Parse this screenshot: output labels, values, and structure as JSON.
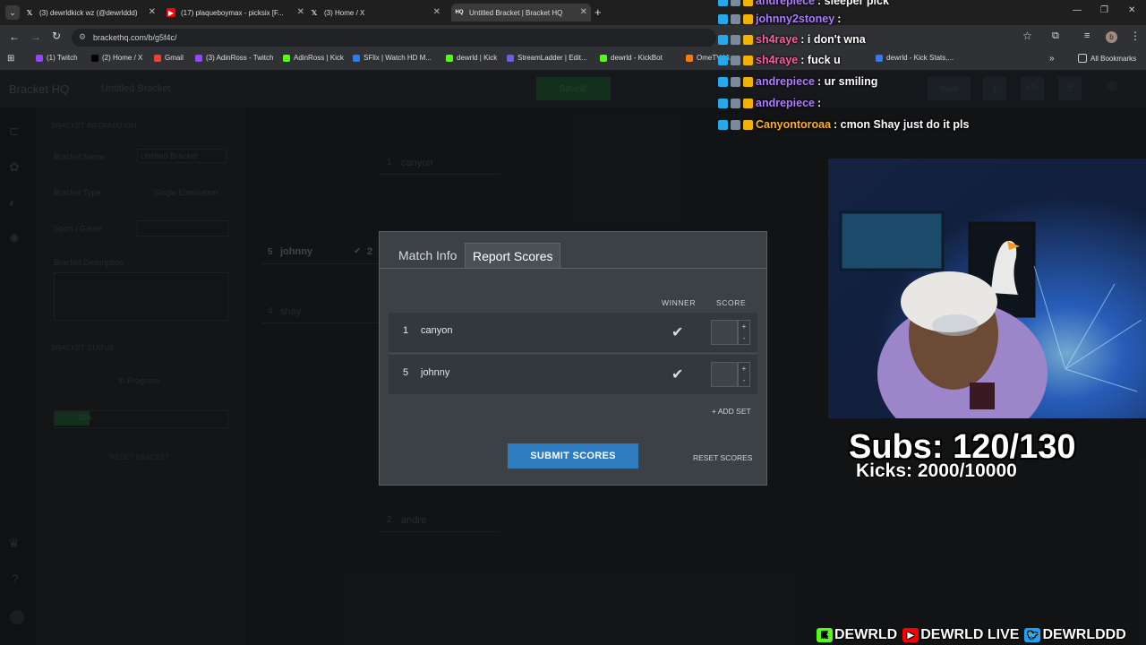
{
  "browser": {
    "tabs": [
      {
        "title": "(3) dewrldkick wz (@dewrlddd)",
        "icon": "x-logo-icon",
        "active": false
      },
      {
        "title": "(17) plaqueboymax - picksix [F...",
        "icon": "youtube-icon",
        "active": false
      },
      {
        "title": "(3) Home / X",
        "icon": "x-logo-icon",
        "active": false
      },
      {
        "title": "Untitled Bracket | Bracket HQ",
        "icon": "brackethq-icon",
        "active": true
      }
    ],
    "url": "brackethq.com/b/g5f4c/",
    "bookmarks": [
      {
        "label": "(1) Twitch",
        "color": "#9146ff"
      },
      {
        "label": "(2) Home / X",
        "color": "#000000"
      },
      {
        "label": "Gmail",
        "color": "#ea4335"
      },
      {
        "label": "(3) AdinRoss - Twitch",
        "color": "#9146ff"
      },
      {
        "label": "AdinRoss | Kick",
        "color": "#53fc18"
      },
      {
        "label": "SFlix | Watch HD M...",
        "color": "#2b7de9"
      },
      {
        "label": "dewrld | Kick",
        "color": "#53fc18"
      },
      {
        "label": "StreamLadder | Edit...",
        "color": "#6c5ce7"
      },
      {
        "label": "dewrld - KickBot",
        "color": "#53fc18"
      },
      {
        "label": "OmeTV Vi...",
        "color": "#ff7a00"
      },
      {
        "label": "dewrld - Kick Stats,...",
        "color": "#3478f6"
      }
    ],
    "all_bookmarks": "All Bookmarks"
  },
  "app": {
    "logo": "Bracket HQ",
    "bracket_title": "Untitled Bracket",
    "saved": "Saved!",
    "save_label": "Save",
    "info": {
      "section_title": "BRACKET INFORMATION",
      "name_label": "Bracket Name",
      "name_value": "Untitled Bracket",
      "type_label": "Bracket Type",
      "type_value": "Single Elimination",
      "sport_label": "Sport / Game",
      "description_label": "Bracket Description",
      "status_title": "BRACKET STATUS",
      "status_value": "In Progress",
      "progress_text": "20%",
      "progress": 0.2,
      "reset_bracket": "RESET BRACKET"
    },
    "bracket": {
      "slots": [
        {
          "seed": "1",
          "name": "canyon"
        },
        {
          "seed": "5",
          "name": "johnny",
          "score": "2"
        },
        {
          "seed": "4",
          "name": "shay"
        },
        {
          "seed": "2",
          "name": "andre"
        }
      ]
    }
  },
  "modal": {
    "tabs": [
      "Match Info",
      "Report Scores"
    ],
    "winner_header": "WINNER",
    "score_header": "SCORE",
    "rows": [
      {
        "seed": "1",
        "name": "canyon"
      },
      {
        "seed": "5",
        "name": "johnny"
      }
    ],
    "add_set": "+ ADD SET",
    "submit": "SUBMIT SCORES",
    "reset": "RESET SCORES"
  },
  "chat": [
    {
      "user": "andrepiece",
      "msg": ": sleeper pick",
      "color": "#b07cff"
    },
    {
      "user": "johnny2stoney",
      "msg": ":",
      "color": "#b07cff"
    },
    {
      "user": "sh4raye",
      "msg": ": i don't wna",
      "color": "#ff5fa2"
    },
    {
      "user": "sh4raye",
      "msg": ": fuck u",
      "color": "#ff5fa2"
    },
    {
      "user": "andrepiece",
      "msg": ": ur smiling",
      "color": "#b07cff"
    },
    {
      "user": "andrepiece",
      "msg": ":",
      "color": "#b07cff"
    },
    {
      "user": "Canyontoroaa",
      "msg": ": cmon Shay just do it pls",
      "color": "#ffb020"
    }
  ],
  "overlay": {
    "subs": "Subs: 120/130",
    "kicks": "Kicks: 2000/10000",
    "socials": [
      "DEWRLD",
      "DEWRLD LIVE",
      "DEWRLDDD"
    ]
  }
}
